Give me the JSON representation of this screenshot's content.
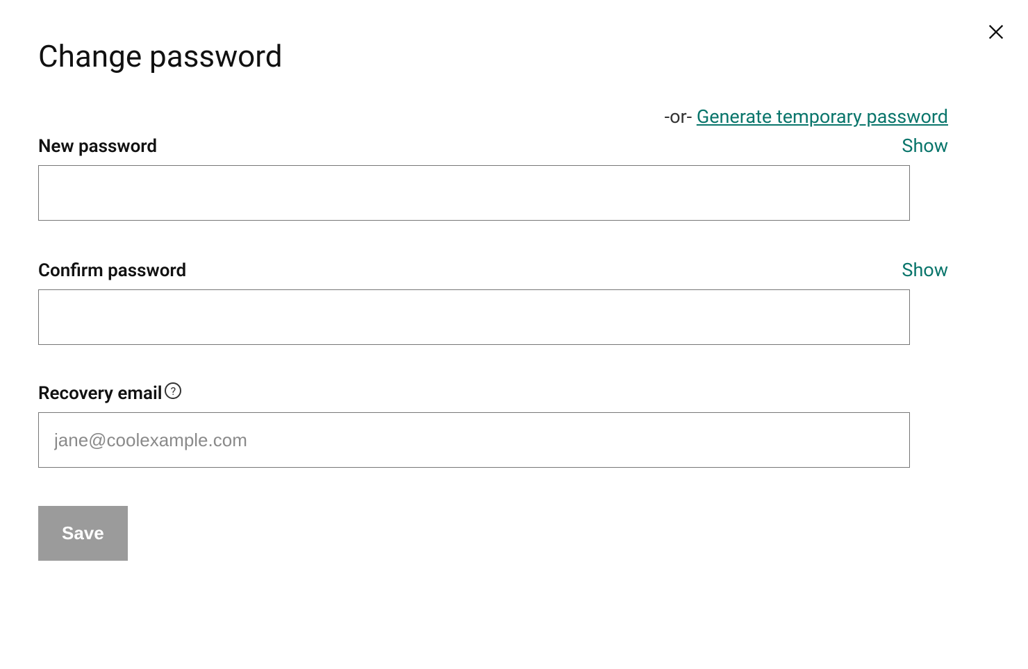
{
  "title": "Change password",
  "or_text": "-or- ",
  "generate_link": "Generate temporary password",
  "fields": {
    "new_password": {
      "label": "New password",
      "show": "Show",
      "value": ""
    },
    "confirm_password": {
      "label": "Confirm password",
      "show": "Show",
      "value": ""
    },
    "recovery_email": {
      "label": "Recovery email",
      "placeholder": "jane@coolexample.com",
      "value": ""
    }
  },
  "save_button": "Save"
}
